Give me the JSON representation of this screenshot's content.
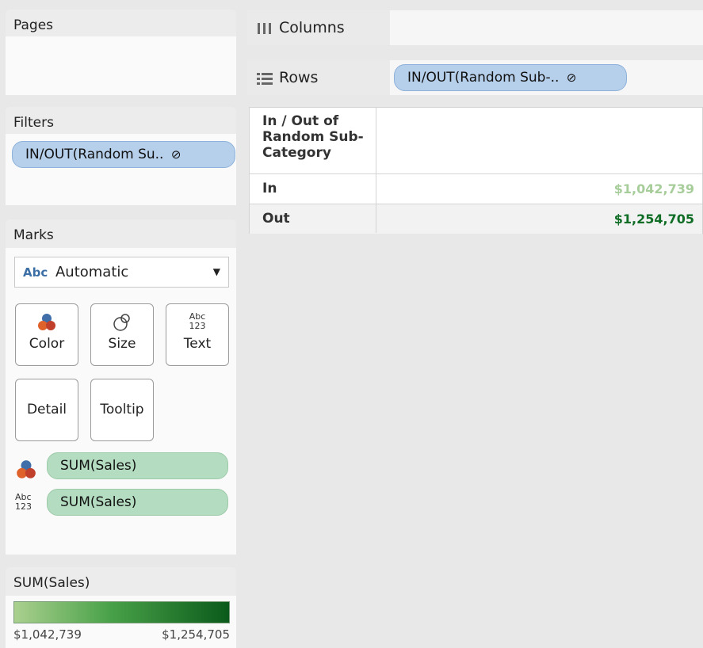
{
  "left": {
    "pages": {
      "title": "Pages"
    },
    "filters": {
      "title": "Filters",
      "pill": "IN/OUT(Random Su..",
      "pill_icon": "link-icon"
    },
    "marks": {
      "title": "Marks",
      "mark_type": {
        "icon_text": "Abc",
        "value": "Automatic"
      },
      "buttons": {
        "color": "Color",
        "size": "Size",
        "text": "Text",
        "detail": "Detail",
        "tooltip": "Tooltip"
      },
      "text_icon": {
        "line1": "Abc",
        "line2": "123"
      },
      "fields": [
        {
          "icon": "color-icon",
          "label": "SUM(Sales)"
        },
        {
          "icon": "text-icon",
          "label": "SUM(Sales)"
        }
      ]
    },
    "legend": {
      "title": "SUM(Sales)",
      "min": "$1,042,739",
      "max": "$1,254,705",
      "color_start": "#aad08f",
      "color_end": "#0b5a1b"
    }
  },
  "shelves": {
    "columns": {
      "label": "Columns",
      "icon": "columns-icon"
    },
    "rows": {
      "label": "Rows",
      "icon": "rows-icon",
      "pill": "IN/OUT(Random Sub-..",
      "pill_icon": "link-icon"
    }
  },
  "table": {
    "header": [
      "In / Out of",
      "Random Sub-",
      "Category"
    ],
    "rows": [
      {
        "label": "In",
        "value": "$1,042,739",
        "color": "#a7cd9a"
      },
      {
        "label": "Out",
        "value": "$1,254,705",
        "color": "#0f6d25"
      }
    ]
  }
}
